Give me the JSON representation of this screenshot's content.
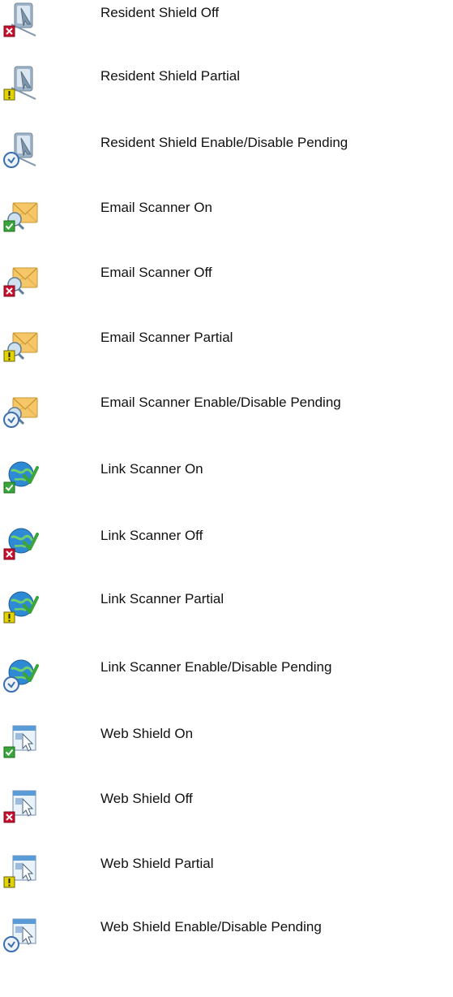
{
  "items": [
    {
      "label": "Resident Shield Off",
      "base_icon": "resident-shield-icon",
      "status_icon": "off-x-icon",
      "status": "off"
    },
    {
      "label": "Resident Shield Partial",
      "base_icon": "resident-shield-icon",
      "status_icon": "partial-exclamation-icon",
      "status": "partial"
    },
    {
      "label": "Resident Shield Enable/Disable Pending",
      "base_icon": "resident-shield-icon",
      "status_icon": "pending-clock-icon",
      "status": "pending"
    },
    {
      "label": "Email Scanner On",
      "base_icon": "email-scanner-icon",
      "status_icon": "on-check-icon",
      "status": "on"
    },
    {
      "label": "Email Scanner Off",
      "base_icon": "email-scanner-icon",
      "status_icon": "off-x-icon",
      "status": "off"
    },
    {
      "label": "Email Scanner Partial",
      "base_icon": "email-scanner-icon",
      "status_icon": "partial-exclamation-icon",
      "status": "partial"
    },
    {
      "label": "Email Scanner Enable/Disable Pending",
      "base_icon": "email-scanner-icon",
      "status_icon": "pending-clock-icon",
      "status": "pending"
    },
    {
      "label": "Link Scanner On",
      "base_icon": "link-scanner-icon",
      "status_icon": "on-check-icon",
      "status": "on"
    },
    {
      "label": "Link Scanner Off",
      "base_icon": "link-scanner-icon",
      "status_icon": "off-x-icon",
      "status": "off"
    },
    {
      "label": "Link Scanner Partial",
      "base_icon": "link-scanner-icon",
      "status_icon": "partial-exclamation-icon",
      "status": "partial"
    },
    {
      "label": "Link Scanner Enable/Disable Pending",
      "base_icon": "link-scanner-icon",
      "status_icon": "pending-clock-icon",
      "status": "pending"
    },
    {
      "label": "Web Shield On",
      "base_icon": "web-shield-icon",
      "status_icon": "on-check-icon",
      "status": "on"
    },
    {
      "label": "Web Shield Off",
      "base_icon": "web-shield-icon",
      "status_icon": "off-x-icon",
      "status": "off"
    },
    {
      "label": "Web Shield Partial",
      "base_icon": "web-shield-icon",
      "status_icon": "partial-exclamation-icon",
      "status": "partial"
    },
    {
      "label": "Web Shield Enable/Disable Pending",
      "base_icon": "web-shield-icon",
      "status_icon": "pending-clock-icon",
      "status": "pending"
    }
  ],
  "colors": {
    "on": "#3aa53a",
    "off": "#c8102e",
    "partial": "#e3d400",
    "pending": "#3b6fb0",
    "envelope": "#f6c768",
    "globe": "#2f8ad6",
    "shield": "#9fb4c8",
    "window": "#5b9bd5"
  }
}
